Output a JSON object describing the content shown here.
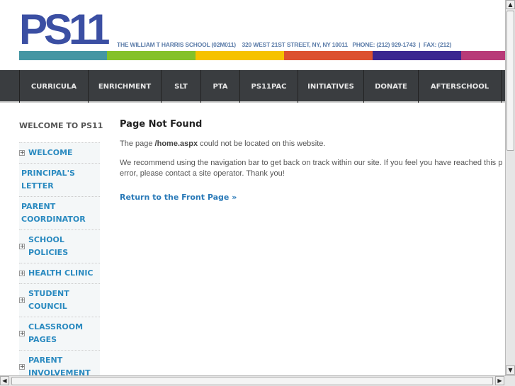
{
  "header": {
    "logo": "PS11",
    "info": "THE WILLIAM T HARRIS SCHOOL (02M011)    320 WEST 21ST STREET, NY, NY 10011   PHONE: (212) 929-1743  |  FAX: (212)",
    "stripe_colors": [
      "#4596a3",
      "#84c129",
      "#f6c200",
      "#dc5130",
      "#3b2690",
      "#b83a78"
    ]
  },
  "nav": [
    "CURRICULA",
    "ENRICHMENT",
    "SLT",
    "PTA",
    "PS11PAC",
    "INITIATIVES",
    "DONATE",
    "AFTERSCHOOL"
  ],
  "sidebar": {
    "title": "WELCOME TO PS11",
    "items": [
      {
        "label": "WELCOME",
        "expand": true
      },
      {
        "label": "PRINCIPAL'S LETTER",
        "expand": false
      },
      {
        "label": "PARENT COORDINATOR",
        "expand": false
      },
      {
        "label": "SCHOOL POLICIES",
        "expand": true
      },
      {
        "label": "HEALTH CLINIC",
        "expand": true
      },
      {
        "label": "STUDENT COUNCIL",
        "expand": true
      },
      {
        "label": "CLASSROOM PAGES",
        "expand": true
      },
      {
        "label": "PARENT INVOLVEMENT",
        "expand": true
      }
    ]
  },
  "main": {
    "title": "Page Not Found",
    "p1_pre": "The page ",
    "p1_bold": "/home.aspx",
    "p1_post": " could not be located on this website.",
    "p2_line1": "We recommend using the navigation bar to get back on track within our site. If you feel you have reached this p",
    "p2_line2": "error, please contact a site operator. Thank you!",
    "link": "Return to the Front Page »"
  }
}
